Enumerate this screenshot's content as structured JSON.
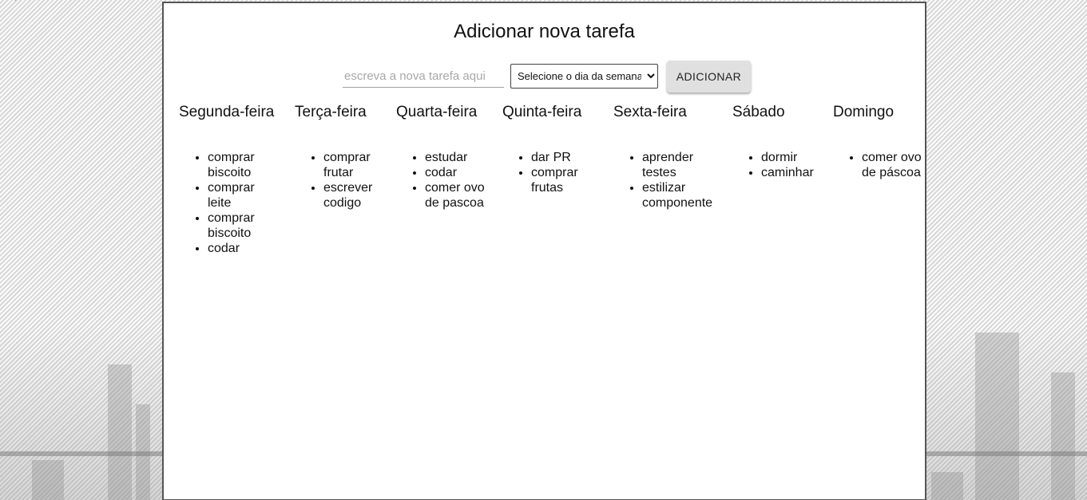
{
  "form": {
    "title": "Adicionar nova tarefa",
    "input_placeholder": "escreva a nova tarefa aqui",
    "select_value": "Selecione o dia da semana",
    "button_label": "ADICIONAR"
  },
  "days": [
    {
      "name": "Segunda-feira",
      "tasks": [
        "comprar biscoito",
        "comprar leite",
        "comprar biscoito",
        "codar"
      ]
    },
    {
      "name": "Terça-feira",
      "tasks": [
        "comprar frutar",
        "escrever codigo"
      ]
    },
    {
      "name": "Quarta-feira",
      "tasks": [
        "estudar",
        "codar",
        "comer ovo de pascoa"
      ]
    },
    {
      "name": "Quinta-feira",
      "tasks": [
        "dar PR",
        "comprar frutas"
      ]
    },
    {
      "name": "Sexta-feira",
      "tasks": [
        "aprender testes",
        "estilizar componente"
      ]
    },
    {
      "name": "Sábado",
      "tasks": [
        "dormir",
        "caminhar"
      ]
    },
    {
      "name": "Domingo",
      "tasks": [
        "comer ovo de páscoa"
      ]
    }
  ]
}
